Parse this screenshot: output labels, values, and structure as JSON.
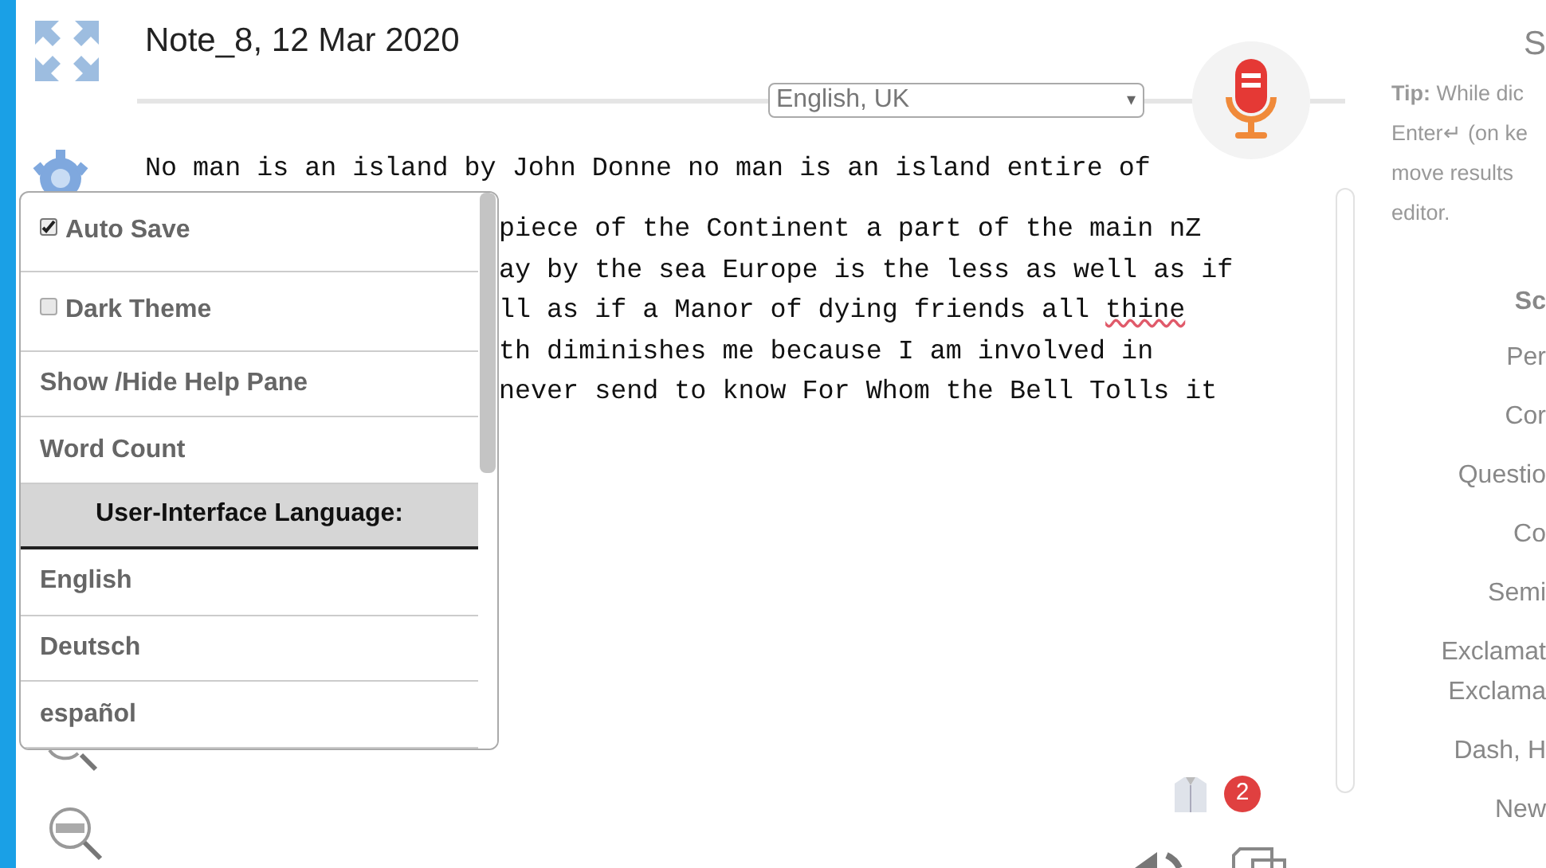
{
  "title": "Note_8, 12 Mar 2020",
  "language_select": {
    "value": "English, UK",
    "arrow": "▾"
  },
  "editor": {
    "first_line": "No man is an island by John Donne no man is an island entire of",
    "visible_line_ends": [
      {
        "text": "piece of the Continent a part of the main nZ"
      },
      {
        "text": "ay by the sea Europe is the less as well as if"
      },
      {
        "text": "ll as if a Manor of dying friends all ",
        "misspelled": "thine"
      },
      {
        "text": "th diminishes me because I am involved in"
      },
      {
        "text": "never send to know For Whom the Bell Tolls it"
      }
    ]
  },
  "settings_menu": [
    {
      "kind": "checkbox",
      "label": "Auto Save",
      "checked": true
    },
    {
      "kind": "checkbox",
      "label": "Dark Theme",
      "checked": false
    },
    {
      "kind": "action",
      "label": "Show /Hide Help Pane"
    },
    {
      "kind": "action",
      "label": "Word Count"
    },
    {
      "kind": "header",
      "label": "User-Interface Language:"
    },
    {
      "kind": "option",
      "label": "English"
    },
    {
      "kind": "option",
      "label": "Deutsch"
    },
    {
      "kind": "option",
      "label": "español"
    }
  ],
  "notification_badge": "2",
  "help_pane": {
    "heading": "S",
    "tip": "**Tip:** While dic\nEnter↵ (on ke\nmove results\neditor.",
    "subheading": "Sc",
    "commands": [
      "Per",
      "Cor",
      "Questio",
      "Co",
      "Semi",
      "Exclamat\nExclama",
      "Dash, H",
      "New"
    ]
  }
}
